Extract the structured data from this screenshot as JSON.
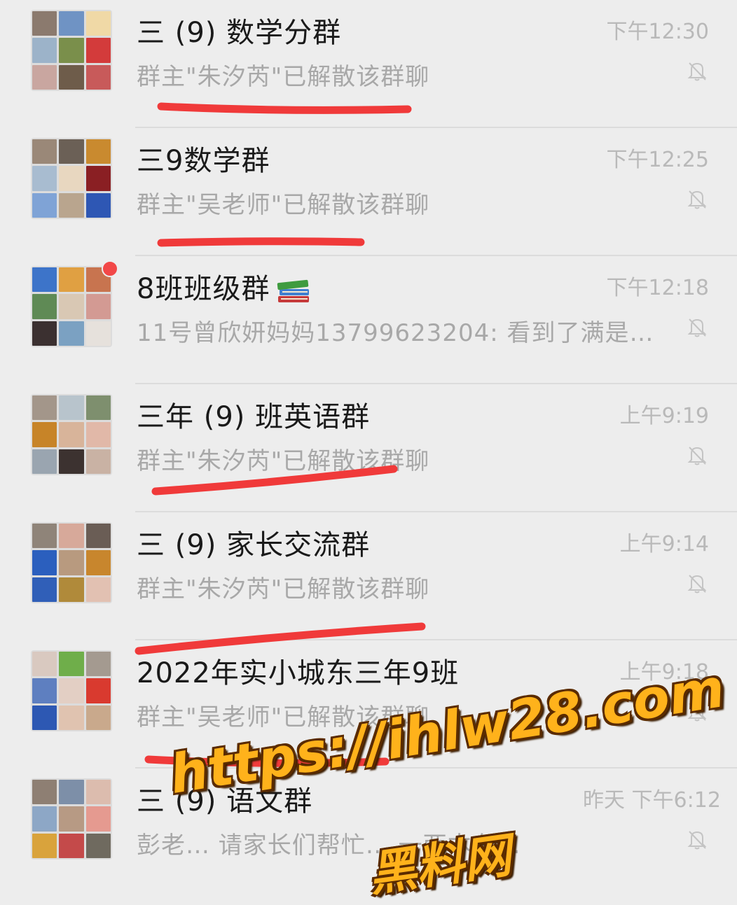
{
  "chats": [
    {
      "title": "三 (9) 数学分群",
      "time": "下午12:30",
      "preview": "群主\"朱汐芮\"已解散该群聊",
      "muted": true,
      "unread": false,
      "avatar_icon": "group-avatar-grid"
    },
    {
      "title": "三9数学群",
      "time": "下午12:25",
      "preview": "群主\"吴老师\"已解散该群聊",
      "muted": true,
      "unread": false,
      "avatar_icon": "group-avatar-grid"
    },
    {
      "title": "8班班级群",
      "title_emoji": "books-emoji",
      "time": "下午12:18",
      "preview": "11号曾欣妍妈妈13799623204: 看到了满是…",
      "muted": true,
      "unread": true,
      "avatar_icon": "group-avatar-grid"
    },
    {
      "title": "三年 (9) 班英语群",
      "time": "上午9:19",
      "preview": "群主\"朱汐芮\"已解散该群聊",
      "muted": true,
      "unread": false,
      "avatar_icon": "group-avatar-grid"
    },
    {
      "title": "三 (9) 家长交流群",
      "time": "上午9:14",
      "preview": "群主\"朱汐芮\"已解散该群聊",
      "muted": true,
      "unread": false,
      "avatar_icon": "group-avatar-grid"
    },
    {
      "title": "2022年实小城东三年9班",
      "time": "上午9:18",
      "preview": "群主\"吴老师\"已解散该群聊",
      "muted": true,
      "unread": false,
      "avatar_icon": "group-avatar-grid"
    },
    {
      "title": "三 (9) 语文群",
      "time": "昨天 下午6:12",
      "preview": "彭老… 请家长们帮忙… 一两本有…",
      "muted": true,
      "unread": false,
      "avatar_icon": "group-avatar-grid"
    }
  ],
  "watermark": {
    "url": "https://ihlw28.com",
    "site_name": "黑料网"
  },
  "colors": {
    "background": "#ededed",
    "title_text": "#1a1a1a",
    "secondary_text": "#a8a8a8",
    "unread_badge": "#f24848",
    "annotation_stroke": "#f03a3a",
    "watermark_fill": "#ffb21b"
  }
}
